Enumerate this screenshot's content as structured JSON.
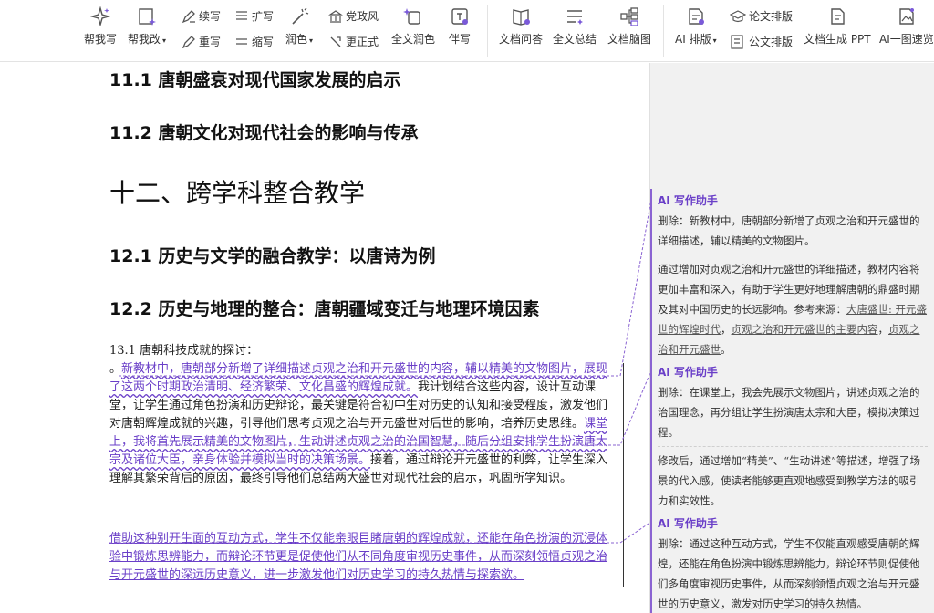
{
  "toolbar": {
    "items": [
      {
        "label": "帮我写",
        "icon": "sparkle-icon"
      },
      {
        "label": "帮我改",
        "icon": "edit-doc-icon",
        "dropdown": true
      },
      {
        "label": "续写",
        "icon": "pen-icon"
      },
      {
        "label": "重写",
        "icon": "pen-icon"
      },
      {
        "label": "扩写",
        "icon": "lines-icon"
      },
      {
        "label": "缩写",
        "icon": "lines-icon"
      },
      {
        "label": "润色",
        "icon": "wand-icon",
        "dropdown": true
      },
      {
        "label": "党政风",
        "icon": "party-icon"
      },
      {
        "label": "更正式",
        "icon": "formal-icon"
      },
      {
        "label": "全文润色",
        "icon": "magic-icon"
      },
      {
        "label": "伴写",
        "icon": "cowrite-icon"
      },
      {
        "label": "文档问答",
        "icon": "book-question-icon"
      },
      {
        "label": "全文总结",
        "icon": "summary-icon"
      },
      {
        "label": "文档脑图",
        "icon": "mindmap-icon"
      },
      {
        "label": "AI 排版",
        "icon": "ai-layout-icon",
        "dropdown": true
      },
      {
        "label": "论文排版",
        "icon": "cap-icon"
      },
      {
        "label": "公文排版",
        "icon": "doc-layout-icon"
      },
      {
        "label": "文档生成 PPT",
        "icon": "ppt-icon"
      },
      {
        "label": "AI一图速览",
        "icon": "image-icon"
      }
    ]
  },
  "document": {
    "h11_1": "11.1  唐朝盛衰对现代国家发展的启示",
    "h11_2": "11.2  唐朝文化对现代社会的影响与传承",
    "h12": "十二、跨学科整合教学",
    "h12_1": "12.1  历史与文学的融合教学：以唐诗为例",
    "h12_2": "12.2  历史与地理的整合：唐朝疆域变迁与地理环境因素",
    "p_intro": "13.1  唐朝科技成就的探讨：",
    "p1_lead": "。",
    "p1_mod1": "新教材中，唐朝部分新增了详细描述贞观之治和开元盛世的内容，辅以精美的文物图片，展现了这两个时期政治清明、经济繁荣、文化昌盛的辉煌成就。",
    "p1_text1": "我计划结合这些内容，设计互动课堂，让学生通过角色扮演和历史辩论，最关键是符合初中生对历史的认知和接受程度，激发他们对唐朝辉煌成就的兴趣，引导他们思考贞观之治与开元盛世对后世的影响，培养历史思维。",
    "p1_mod2": "课堂上，我将首先展示精美的文物图片，生动讲述贞观之治的治国智慧，随后分组安排学生扮演唐太宗及诸位大臣，亲身体验并模拟当时的决策场景。",
    "p1_text2": "接着，通过辩论开元盛世的利弊，让学生深入理解其繁荣背后的原因，最终引导他们总结两大盛世对现代社会的启示，巩固所学知识。",
    "p2_mod": "借助这种别开生面的互动方式，学生不仅能亲眼目睹唐朝的辉煌成就，还能在角色扮演的沉浸体验中锻炼思辨能力，而辩论环节更是促使他们从不同角度审视历史事件，从而深刻领悟贞观之治与开元盛世的深远历史意义，进一步激发他们对历史学习的持久热情与探索欲。"
  },
  "panel": {
    "cards": [
      {
        "title": "AI 写作助手",
        "line1": "删除：新教材中，唐朝部分新增了贞观之治和开元盛世的详细描述，辅以精美的文物图片。",
        "line2": "通过增加对贞观之治和开元盛世的详细描述，教材内容将更加丰富和深入，有助于学生更好地理解唐朝的鼎盛时期及其对中国历史的长远影响。参考来源：",
        "ref1": "大唐盛世: 开元盛世的辉煌时代",
        "sep1": "，",
        "ref2": "贞观之治和开元盛世的主要内容",
        "sep2": "，",
        "ref3": "贞观之治和开元盛世",
        "tail": "。"
      },
      {
        "title": "AI 写作助手",
        "line1": "删除：在课堂上，我会先展示文物图片，讲述贞观之治的治国理念，再分组让学生扮演唐太宗和大臣，模拟决策过程。",
        "line2": "修改后，通过增加“精美”、“生动讲述”等描述，增强了场景的代入感，使读者能够更直观地感受到教学方法的吸引力和实效性。"
      },
      {
        "title": "AI 写作助手",
        "line1": "删除：通过这种互动方式，学生不仅能直观感受唐朝的辉煌，还能在角色扮演中锻炼思辨能力，辩论环节则促使他们多角度审视历史事件，从而深刻领悟贞观之治与开元盛世的历史意义，激发对历史学习的持久热情。"
      }
    ]
  },
  "colors": {
    "accent": "#6a3fc8",
    "panel_bg": "#f1f1f1",
    "icon": "#7a5ad8"
  }
}
